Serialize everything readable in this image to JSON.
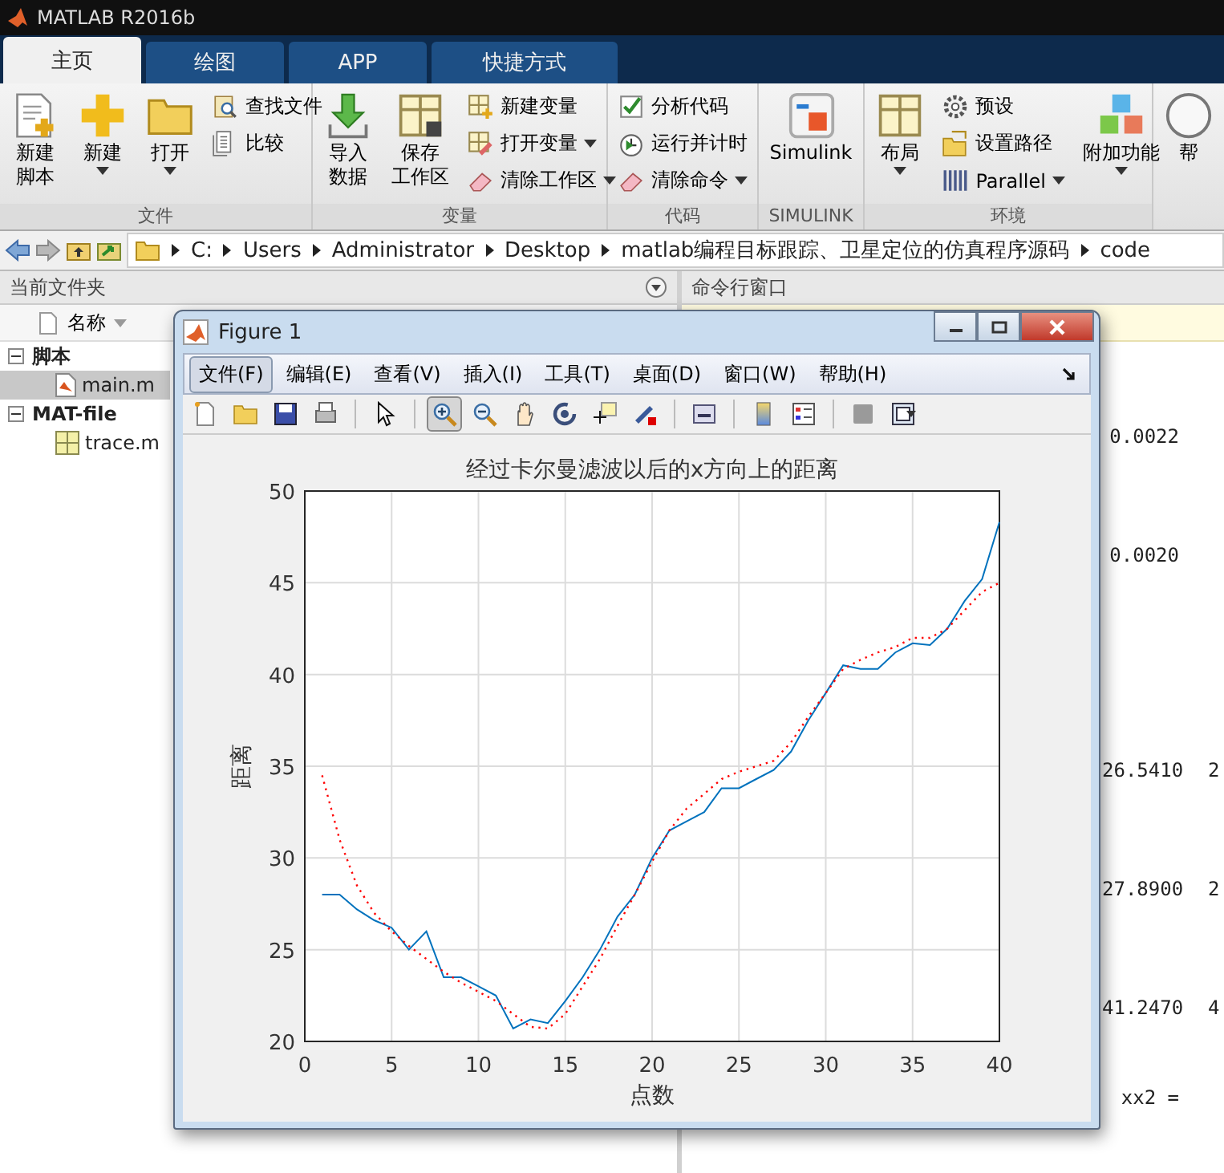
{
  "window": {
    "title": "MATLAB R2016b"
  },
  "tabs": [
    {
      "label": "主页",
      "selected": true
    },
    {
      "label": "绘图",
      "selected": false
    },
    {
      "label": "APP",
      "selected": false
    },
    {
      "label": "快捷方式",
      "selected": false
    }
  ],
  "toolstrip": {
    "groups": [
      {
        "label": "文件",
        "buttons": [
          {
            "kind": "large",
            "lines": [
              "新建",
              "脚本"
            ],
            "dropdown": false
          },
          {
            "kind": "large",
            "label": "新建",
            "dropdown": true
          },
          {
            "kind": "large",
            "label": "打开",
            "dropdown": true
          },
          {
            "kind": "small",
            "label": "查找文件",
            "dropdown": false
          },
          {
            "kind": "small",
            "label": "比较",
            "dropdown": false
          }
        ]
      },
      {
        "label": "变量",
        "buttons": [
          {
            "kind": "large",
            "lines": [
              "导入",
              "数据"
            ],
            "dropdown": false
          },
          {
            "kind": "large",
            "lines": [
              "保存",
              "工作区"
            ],
            "dropdown": false
          },
          {
            "kind": "small",
            "label": "新建变量",
            "dropdown": false
          },
          {
            "kind": "small",
            "label": "打开变量",
            "dropdown": true
          },
          {
            "kind": "small",
            "label": "清除工作区",
            "dropdown": true
          }
        ]
      },
      {
        "label": "代码",
        "buttons": [
          {
            "kind": "small",
            "label": "分析代码",
            "dropdown": false
          },
          {
            "kind": "small",
            "label": "运行并计时",
            "dropdown": false
          },
          {
            "kind": "small",
            "label": "清除命令",
            "dropdown": true
          }
        ]
      },
      {
        "label": "SIMULINK",
        "buttons": [
          {
            "kind": "large",
            "label": "Simulink",
            "dropdown": false
          }
        ]
      },
      {
        "label": "环境",
        "buttons": [
          {
            "kind": "large",
            "label": "布局",
            "dropdown": true
          },
          {
            "kind": "small",
            "label": "预设",
            "dropdown": false
          },
          {
            "kind": "small",
            "label": "设置路径",
            "dropdown": false
          },
          {
            "kind": "small",
            "label": "Parallel",
            "dropdown": true
          },
          {
            "kind": "large",
            "label": "附加功能",
            "dropdown": true
          }
        ]
      },
      {
        "buttons": [
          {
            "kind": "large",
            "label": "帮",
            "dropdown": false
          }
        ]
      }
    ]
  },
  "address_bar": {
    "path": [
      "C:",
      "Users",
      "Administrator",
      "Desktop",
      "matlab编程目标跟踪、卫星定位的仿真程序源码",
      "code"
    ]
  },
  "current_folder": {
    "title": "当前文件夹",
    "column": "名称",
    "tree": [
      {
        "label": "脚本",
        "expanded": true,
        "children": [
          {
            "label": "main.m",
            "kind": "script",
            "selected": true
          }
        ]
      },
      {
        "label": "MAT-file",
        "expanded": true,
        "children": [
          {
            "label": "trace.m",
            "kind": "mat",
            "selected": false
          }
        ]
      }
    ]
  },
  "command_window": {
    "title": "命令行窗口",
    "lines": [
      {
        "column_1": "0.0022"
      },
      {
        "column_1": "0.0020"
      },
      {
        "column_1": "26.5410",
        "column_2": "2"
      },
      {
        "column_1": "27.8900",
        "column_2": "2"
      },
      {
        "column_1": "41.2470",
        "column_2": "4"
      },
      {
        "column_1": "xx2 ="
      }
    ]
  },
  "figure": {
    "title": "Figure 1",
    "menu": [
      {
        "label": "文件(F)",
        "selected": true
      },
      {
        "label": "编辑(E)",
        "selected": false
      },
      {
        "label": "查看(V)",
        "selected": false
      },
      {
        "label": "插入(I)",
        "selected": false
      },
      {
        "label": "工具(T)",
        "selected": false
      },
      {
        "label": "桌面(D)",
        "selected": false
      },
      {
        "label": "窗口(W)",
        "selected": false
      },
      {
        "label": "帮助(H)",
        "selected": false
      }
    ],
    "chart_data": {
      "type": "line",
      "title": "经过卡尔曼滤波以后的x方向上的距离",
      "xlabel": "点数",
      "ylabel": "距离",
      "xlim": [
        0,
        40
      ],
      "ylim": [
        20,
        50
      ],
      "xticks": [
        0,
        5,
        10,
        15,
        20,
        25,
        30,
        35,
        40
      ],
      "yticks": [
        20,
        25,
        30,
        35,
        40,
        45,
        50
      ],
      "grid": true,
      "x": [
        1,
        2,
        3,
        4,
        5,
        6,
        7,
        8,
        9,
        10,
        11,
        12,
        13,
        14,
        15,
        16,
        17,
        18,
        19,
        20,
        21,
        22,
        23,
        24,
        25,
        26,
        27,
        28,
        29,
        30,
        31,
        32,
        33,
        34,
        35,
        36,
        37,
        38,
        39,
        40
      ],
      "series": [
        {
          "color": "#0072bd",
          "line_style": "solid",
          "values": [
            28,
            28,
            27.2,
            26.6,
            26.2,
            25,
            26,
            23.5,
            23.5,
            23,
            22.5,
            20.7,
            21.2,
            21,
            22.2,
            23.5,
            25,
            26.8,
            28,
            30,
            31.5,
            32,
            32.5,
            33.8,
            33.8,
            34.3,
            34.8,
            35.8,
            37.5,
            39,
            40.5,
            40.3,
            40.3,
            41.2,
            41.7,
            41.6,
            42.5,
            44,
            45.2,
            48.3
          ]
        },
        {
          "color": "#ff0000",
          "line_style": "dotted",
          "values": [
            34.5,
            31,
            28.5,
            27,
            26,
            25.2,
            24.5,
            23.8,
            23.2,
            22.7,
            22.2,
            21.5,
            20.8,
            20.7,
            21.5,
            23,
            24.5,
            26.3,
            28,
            29.8,
            31.5,
            32.7,
            33.5,
            34.3,
            34.7,
            35,
            35.3,
            36.3,
            37.7,
            39,
            40.3,
            40.8,
            41.2,
            41.5,
            42,
            42,
            42.5,
            43.5,
            44.5,
            45
          ]
        }
      ]
    }
  }
}
